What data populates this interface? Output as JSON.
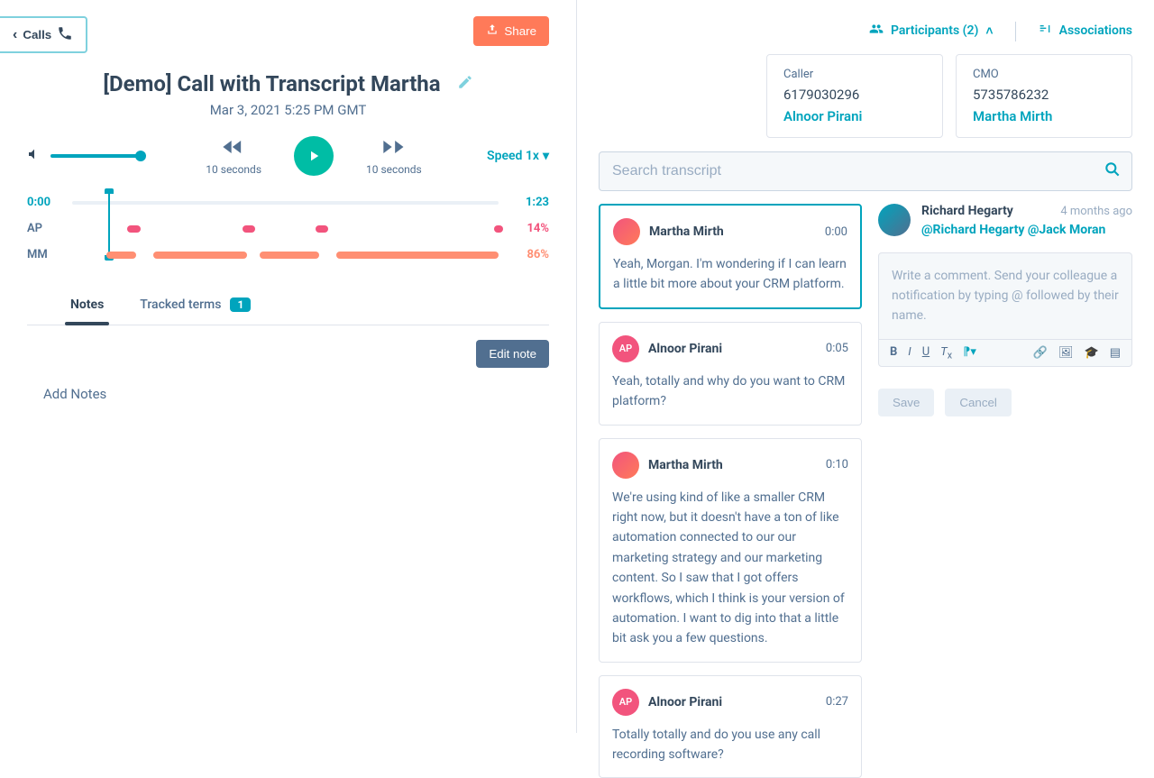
{
  "header": {
    "back_label": "Calls",
    "share_label": "Share",
    "title": "[Demo] Call with Transcript Martha",
    "subtitle": "Mar 3, 2021 5:25 PM GMT"
  },
  "player": {
    "rewind_label": "10 seconds",
    "forward_label": "10 seconds",
    "speed_label": "Speed 1x"
  },
  "timeline": {
    "start": "0:00",
    "end": "1:23",
    "speakers": [
      {
        "initials": "AP",
        "pct": "14%",
        "color": "pink"
      },
      {
        "initials": "MM",
        "pct": "86%",
        "color": "orange"
      }
    ]
  },
  "tabs": {
    "notes": "Notes",
    "tracked": "Tracked terms",
    "tracked_count": "1"
  },
  "notes": {
    "edit_button": "Edit note",
    "placeholder": "Add Notes"
  },
  "right_header": {
    "participants_label": "Participants (2)",
    "associations_label": "Associations"
  },
  "participants": [
    {
      "role": "Caller",
      "phone": "6179030296",
      "name": "Alnoor Pirani"
    },
    {
      "role": "CMO",
      "phone": "5735786232",
      "name": "Martha Mirth"
    }
  ],
  "search": {
    "placeholder": "Search transcript"
  },
  "transcript": [
    {
      "speaker": "Martha Mirth",
      "avatar": "mm",
      "time": "0:00",
      "text": "Yeah, Morgan. I'm wondering if I can learn a little bit more about your CRM platform.",
      "active": true
    },
    {
      "speaker": "Alnoor Pirani",
      "avatar": "ap",
      "time": "0:05",
      "text": "Yeah, totally and why do you want to CRM platform?",
      "active": false
    },
    {
      "speaker": "Martha Mirth",
      "avatar": "mm",
      "time": "0:10",
      "text": "We're using kind of like a smaller CRM right now, but it doesn't have a ton of like automation connected to our our marketing strategy and our marketing content. So I saw that I got offers workflows, which I think is your version of automation. I want to dig into that a little bit ask you a few questions.",
      "active": false
    },
    {
      "speaker": "Alnoor Pirani",
      "avatar": "ap",
      "time": "0:27",
      "text": "Totally totally and do you use any call recording software?",
      "active": false
    }
  ],
  "comments": [
    {
      "author": "Richard Hegarty",
      "ago": "4 months ago",
      "mentions": "@Richard Hegarty @Jack Moran"
    }
  ],
  "editor": {
    "placeholder": "Write a comment. Send your colleague a notification by typing @ followed by their name.",
    "save": "Save",
    "cancel": "Cancel"
  }
}
